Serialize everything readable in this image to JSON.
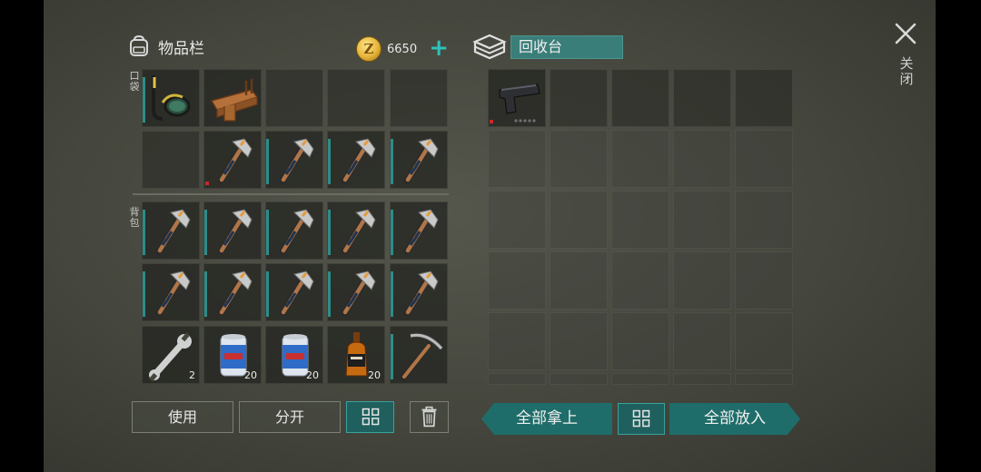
{
  "inventory": {
    "title": "物品栏",
    "pocket_label": "口袋",
    "backpack_label": "背包",
    "coins": "6650",
    "coin_symbol": "Z",
    "slots": [
      {
        "name": "snorkel-mask-item",
        "icon": "snorkel-mask",
        "qty": "",
        "bar": true
      },
      {
        "name": "wooden-tray-item",
        "icon": "wooden-tray",
        "qty": ""
      },
      {
        "name": "empty-slot",
        "icon": "",
        "qty": ""
      },
      {
        "name": "empty-slot",
        "icon": "",
        "qty": ""
      },
      {
        "name": "empty-slot",
        "icon": "",
        "qty": ""
      },
      {
        "name": "empty-slot",
        "icon": "",
        "qty": ""
      },
      {
        "name": "hatchet-item",
        "icon": "hatchet",
        "qty": "",
        "red": true
      },
      {
        "name": "hatchet-item",
        "icon": "hatchet",
        "qty": "",
        "bar": true
      },
      {
        "name": "hatchet-item",
        "icon": "hatchet",
        "qty": "",
        "bar": true
      },
      {
        "name": "hatchet-item",
        "icon": "hatchet",
        "qty": "",
        "bar": true
      },
      {
        "name": "hatchet-item",
        "icon": "hatchet",
        "qty": "",
        "bar": true
      },
      {
        "name": "hatchet-item",
        "icon": "hatchet",
        "qty": "",
        "bar": true
      },
      {
        "name": "hatchet-item",
        "icon": "hatchet",
        "qty": "",
        "bar": true
      },
      {
        "name": "hatchet-item",
        "icon": "hatchet",
        "qty": "",
        "bar": true
      },
      {
        "name": "hatchet-item",
        "icon": "hatchet",
        "qty": "",
        "bar": true
      },
      {
        "name": "hatchet-item",
        "icon": "hatchet",
        "qty": "",
        "bar": true
      },
      {
        "name": "hatchet-item",
        "icon": "hatchet",
        "qty": "",
        "bar": true
      },
      {
        "name": "hatchet-item",
        "icon": "hatchet",
        "qty": "",
        "bar": true
      },
      {
        "name": "hatchet-item",
        "icon": "hatchet",
        "qty": "",
        "bar": true
      },
      {
        "name": "hatchet-item",
        "icon": "hatchet",
        "qty": "",
        "bar": true
      },
      {
        "name": "wrench-item",
        "icon": "wrench",
        "qty": "2"
      },
      {
        "name": "beer-can-item",
        "icon": "beer-can",
        "qty": "20"
      },
      {
        "name": "beer-can-item",
        "icon": "beer-can",
        "qty": "20"
      },
      {
        "name": "whiskey-bottle-item",
        "icon": "whiskey-bottle",
        "qty": "20"
      },
      {
        "name": "pickaxe-item",
        "icon": "pickaxe",
        "qty": "",
        "bar": true
      }
    ],
    "buttons": {
      "use": "使用",
      "split": "分开"
    }
  },
  "recycler": {
    "title": "回收台",
    "slots_filled": [
      {
        "name": "pistol-item",
        "icon": "pistol"
      }
    ],
    "take_all": "全部拿上",
    "put_all": "全部放入"
  },
  "close_label": "关闭",
  "colors": {
    "accent": "#2c8d8a",
    "teal_button": "#1f6d6a",
    "coin": "#e5b43a",
    "rarity_red": "#d0262b"
  }
}
